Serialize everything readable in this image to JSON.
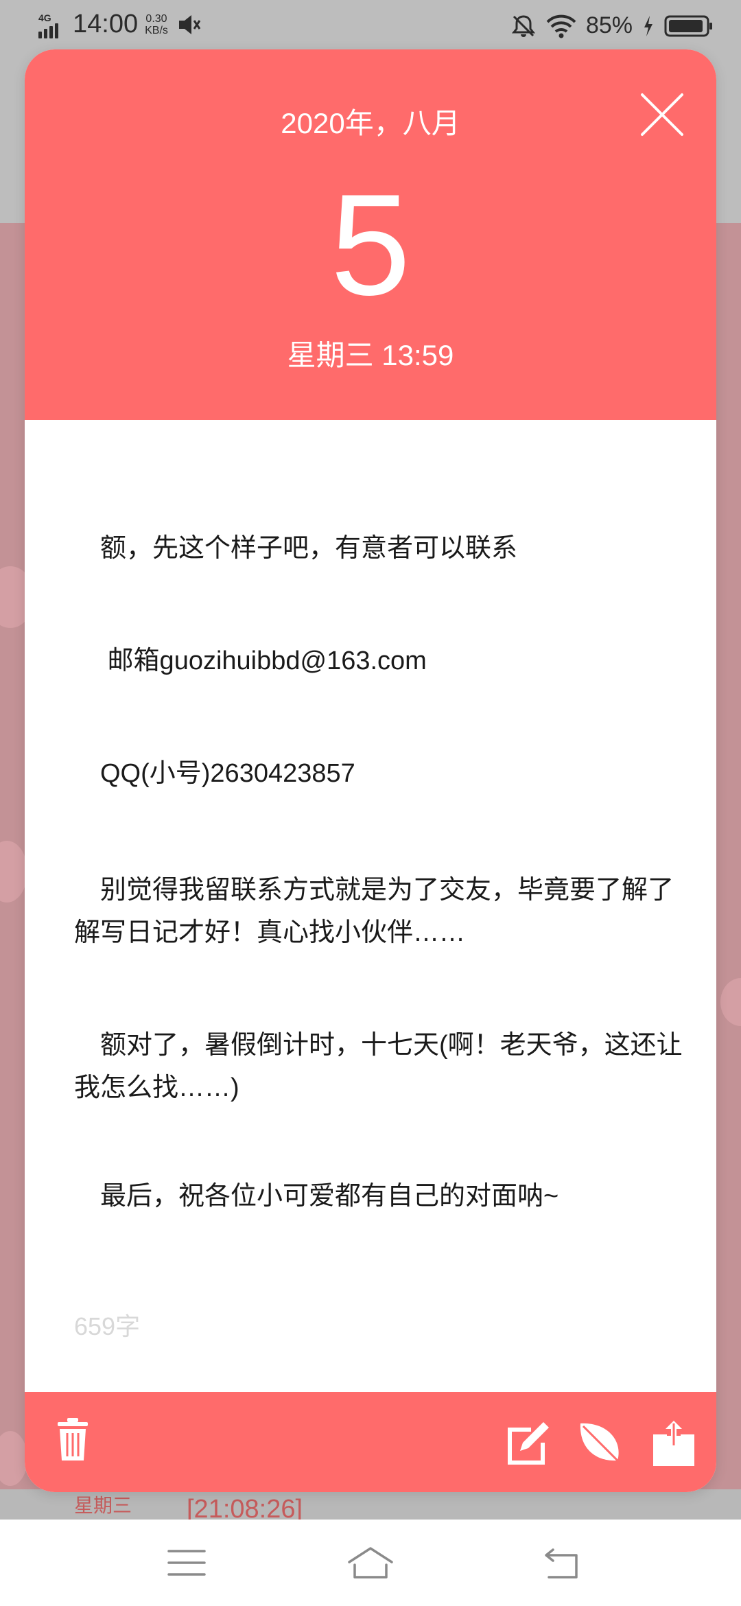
{
  "status_bar": {
    "network": "4G",
    "time": "14:00",
    "speed_value": "0.30",
    "speed_unit": "KB/s",
    "battery": "85%"
  },
  "card": {
    "month": "2020年，八月",
    "day": "5",
    "weekday_time": "星期三 13:59",
    "paragraphs": [
      "　额，先这个样子吧，有意者可以联系",
      "　 邮箱guozihuibbd@163.com",
      "　QQ(小号)2630423857",
      "　别觉得我留联系方式就是为了交友，毕竟要了解了解写日记才好！真心找小伙伴……",
      "　额对了，暑假倒计时，十七天(啊！老天爷，这还让我怎么找……)",
      "　最后，祝各位小可爱都有自己的对面呐~"
    ],
    "word_count": "659字"
  },
  "background_list": {
    "weekday": "星期三",
    "time": "[21:08:26]"
  },
  "colors": {
    "accent": "#ff6b6b",
    "scrim": "#b99094",
    "text": "#1a1a1a",
    "muted": "#d8d8d8"
  },
  "icons": {
    "toolbar": [
      "trash-icon",
      "edit-icon",
      "leaf-icon",
      "share-icon"
    ],
    "nav": [
      "menu-icon",
      "home-icon",
      "back-icon"
    ]
  }
}
